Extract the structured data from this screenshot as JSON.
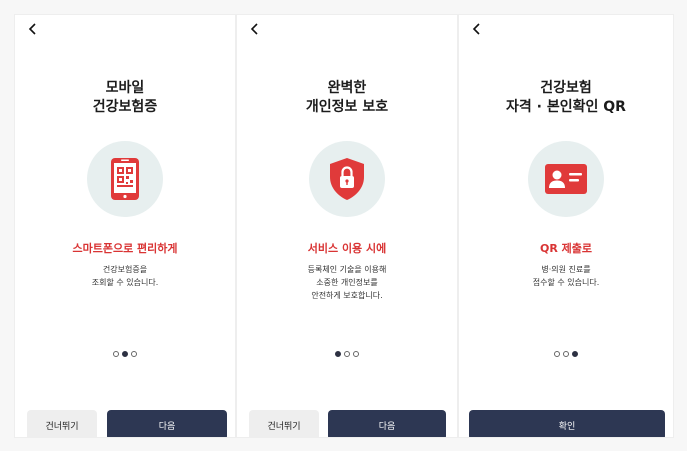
{
  "screens": [
    {
      "title_lines": [
        "모바일",
        "건강보험증"
      ],
      "icon": "smartphone-qr-icon",
      "subtitle": "스마트폰으로 편리하게",
      "desc_lines": [
        "건강보험증을",
        "조회할 수 있습니다."
      ],
      "page_index": 2,
      "page_count": 3,
      "skip_label": "건너뛰기",
      "next_label": "다음"
    },
    {
      "title_lines": [
        "완벽한",
        "개인정보 보호"
      ],
      "icon": "shield-lock-icon",
      "subtitle": "서비스 이용 시에",
      "desc_lines": [
        "등록체인 기술을 이용해",
        "소중한 개인정보를",
        "안전하게 보호합니다."
      ],
      "page_index": 1,
      "page_count": 3,
      "skip_label": "건너뛰기",
      "next_label": "다음"
    },
    {
      "title_lines": [
        "건강보험",
        "자격 · 본인확인 QR"
      ],
      "icon": "id-card-icon",
      "subtitle": "QR 제출로",
      "desc_lines": [
        "병·의원 진료를",
        "접수할 수 있습니다."
      ],
      "page_index": 3,
      "page_count": 3,
      "confirm_label": "확인"
    }
  ],
  "colors": {
    "accent_red": "#e03a3a",
    "subtitle_red": "#d93434",
    "button_navy": "#2d3753",
    "circle_bg": "#e7efef"
  }
}
